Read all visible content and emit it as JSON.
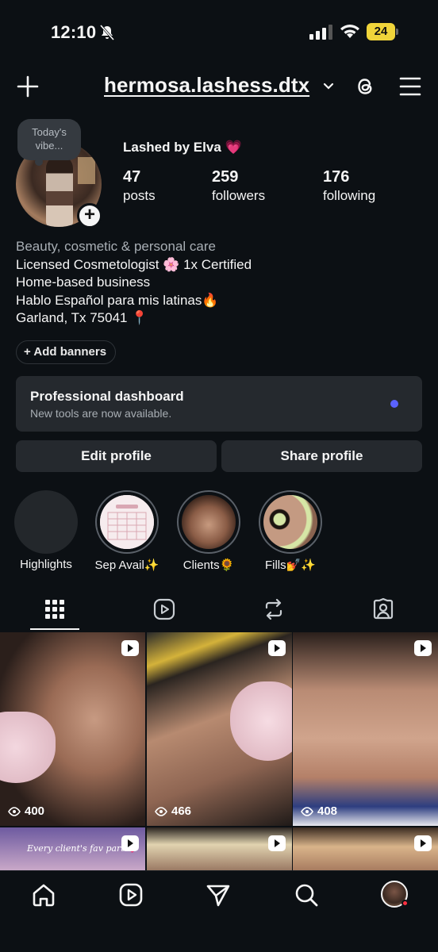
{
  "status_bar": {
    "time": "12:10",
    "battery": "24"
  },
  "header": {
    "username": "hermosa.lashess.dtx"
  },
  "profile": {
    "note": "Today's vibe...",
    "display_name": "Lashed by Elva 💗",
    "stats": [
      {
        "value": "47",
        "label": "posts"
      },
      {
        "value": "259",
        "label": "followers"
      },
      {
        "value": "176",
        "label": "following"
      }
    ],
    "category": "Beauty, cosmetic & personal care",
    "bio_lines": [
      "Licensed Cosmetologist 🌸 1x Certified",
      "Home-based business",
      "Hablo Español para mis latinas🔥",
      "Garland, Tx 75041 📍"
    ],
    "add_banners": "+ Add banners"
  },
  "dashboard": {
    "title": "Professional dashboard",
    "subtitle": "New tools are now available."
  },
  "buttons": {
    "edit": "Edit profile",
    "share": "Share profile"
  },
  "highlights": [
    {
      "label": "Highlights"
    },
    {
      "label": "Sep Avail✨"
    },
    {
      "label": "Clients🌻"
    },
    {
      "label": "Fills💅✨"
    }
  ],
  "grid": [
    {
      "views": "400"
    },
    {
      "views": "466"
    },
    {
      "views": "408"
    },
    {
      "caption": "Every client's fav part 💗"
    }
  ],
  "colors": {
    "background": "#0c1014",
    "card": "#25292e",
    "accent_dot": "#5a62ff",
    "battery": "#f0d43a",
    "notification": "#ff3040"
  },
  "icons": [
    "bell-slash-icon",
    "signal-icon",
    "wifi-icon",
    "plus-icon",
    "chevron-down-icon",
    "threads-icon",
    "menu-icon",
    "grid-icon",
    "reels-icon",
    "reposts-icon",
    "tagged-icon",
    "home-icon",
    "reels-nav-icon",
    "send-icon",
    "search-icon",
    "eye-icon",
    "reel-badge-icon"
  ]
}
